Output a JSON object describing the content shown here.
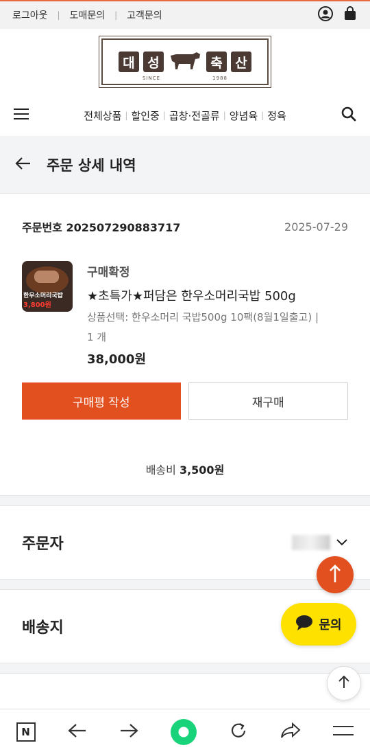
{
  "top_util": {
    "links": [
      "로그아웃",
      "도매문의",
      "고객문의"
    ]
  },
  "logo": {
    "chars": [
      "대",
      "성",
      "축",
      "산"
    ],
    "since": "SINCE",
    "year": "1988"
  },
  "nav": {
    "items": [
      "전체상품",
      "할인중",
      "곱창·전골류",
      "양념육",
      "정육"
    ]
  },
  "page": {
    "title": "주문 상세 내역"
  },
  "order": {
    "number_label": "주문번호 202507290883717",
    "date": "2025-07-29",
    "status": "구매확정",
    "product_name": "★초특가★퍼담은 한우소머리국밥 500g",
    "option": "상품선택: 한우소머리 국밥500g 10팩(8월1일출고) |",
    "qty": "1 개",
    "price": "38,000원",
    "thumb_text1": "한우소머리국밥",
    "thumb_text2": "3,800원"
  },
  "buttons": {
    "review": "구매평 작성",
    "reorder": "재구매"
  },
  "shipping_fee": {
    "label": "배송비",
    "value": "3,500원"
  },
  "sections": {
    "orderer": "주문자",
    "delivery": "배송지"
  },
  "chat": {
    "label": "문의"
  },
  "colors": {
    "accent": "#e2501f",
    "chat": "#ffe100",
    "browser_green": "#19d37a"
  }
}
